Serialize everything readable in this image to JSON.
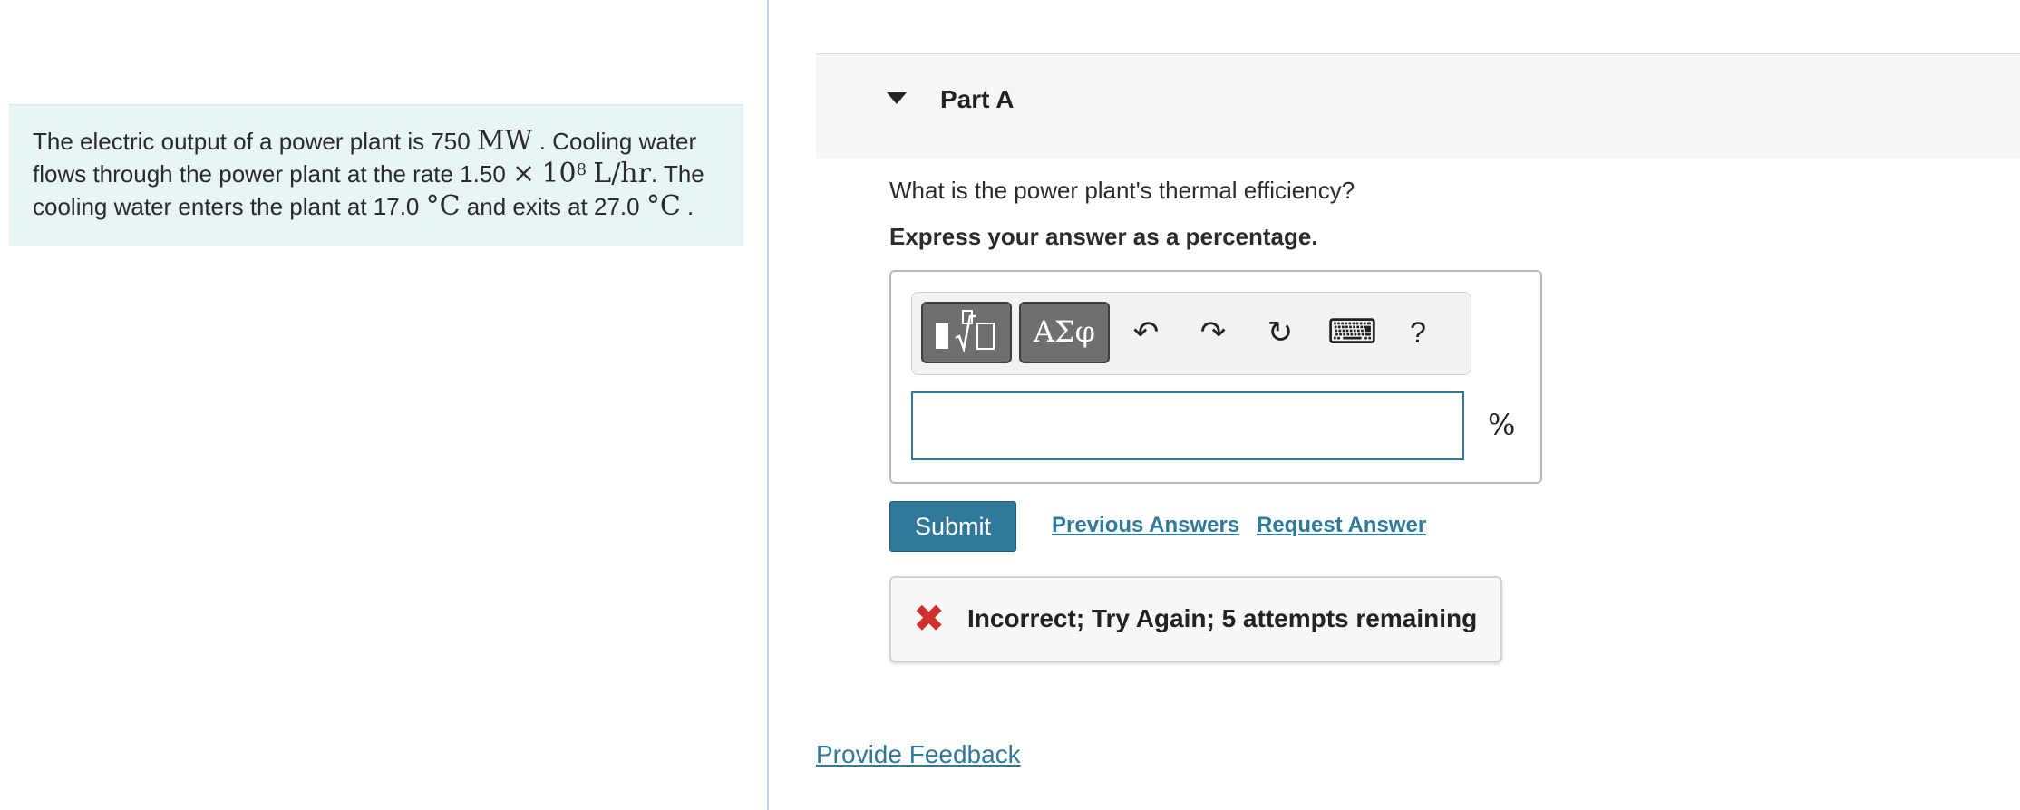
{
  "problem": {
    "text_1": "The electric output of a power plant is 750 ",
    "power_unit": "MW",
    "text_2": " . Cooling water flows through the power plant at the rate 1.50 ",
    "times": "×",
    "base": "10",
    "exponent": "8",
    "flow_unit": "L/hr",
    "text_3": ". The cooling water enters the plant at 17.0 ",
    "temp_unit_1": "°C",
    "text_4": " and exits at 27.0 ",
    "temp_unit_2": "°C",
    "text_5": " ."
  },
  "part": {
    "title": "Part A",
    "question": "What is the power plant's thermal efficiency?",
    "instruction": "Express your answer as a percentage."
  },
  "toolbar": {
    "greek_label": "ΑΣφ",
    "undo_glyph": "↶",
    "redo_glyph": "↷",
    "reset_glyph": "↻",
    "keyboard_glyph": "⌨",
    "help_label": "?"
  },
  "answer": {
    "value": "",
    "unit": "%"
  },
  "actions": {
    "submit_label": "Submit",
    "previous_answers_label": "Previous Answers",
    "request_answer_label": "Request Answer"
  },
  "feedback": {
    "icon": "x-icon",
    "message": "Incorrect; Try Again; 5 attempts remaining",
    "icon_color": "#d0312d"
  },
  "footer": {
    "provide_feedback_label": "Provide Feedback"
  },
  "colors": {
    "accent": "#2f7a9a",
    "problem_bg": "#e8f4f5"
  }
}
